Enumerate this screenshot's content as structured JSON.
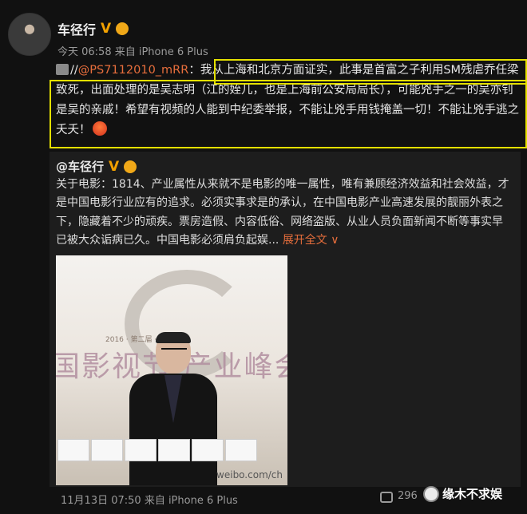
{
  "post": {
    "author": "车径行",
    "verified_badge": "V",
    "meta": "今天 06:58 来自 iPhone 6 Plus",
    "repost_prefix": "//",
    "mention": "@PS7112010_mRR",
    "mention_colon": "：",
    "repost_text": "我从上海和北京方面证实，此事是首富之子利用SM残虐乔任梁致死，出面处理的是吴志明（江的姪儿，也是上海前公安局局长），可能兇手之一的吴亦钊是吴的亲戚！希望有视频的人能到中纪委举报，不能让兇手用钱掩盖一切！不能让兇手逃之夭夭！"
  },
  "original": {
    "author": "@车径行",
    "verified_badge": "V",
    "text": "关于电影：1814、产业属性从来就不是电影的唯一属性，唯有兼顾经济效益和社会效益，才是中国电影行业应有的追求。必须实事求是的承认，在中国电影产业高速发展的靓丽外表之下，隐藏着不少的顽疾。票房造假、内容低俗、网络盗版、从业人员负面新闻不断等事实早已被大众诟病已久。中国电影必须肩负起娱...",
    "expand_label": "展开全文 ∨",
    "photo": {
      "banner_small": "2016 · 第二届 · 山海关",
      "banner_text": "国影视节 产业峰会",
      "watermark": "weibo.com/ch"
    }
  },
  "footer": {
    "date_meta": "11月13日 07:50 来自 iPhone 6 Plus",
    "count": "296",
    "watermark_text": "缘木不求娱"
  },
  "colors": {
    "background": "#111111",
    "mention": "#e76e3c",
    "highlight_box": "#e4e000",
    "verified": "#f2a100"
  }
}
